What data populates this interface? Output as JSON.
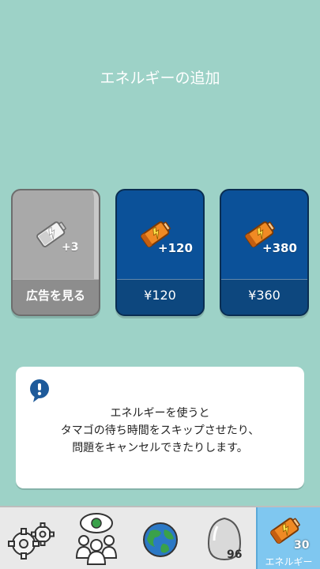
{
  "header": {
    "title": "エネルギーの追加"
  },
  "cards": [
    {
      "amount": "+3",
      "price": "広告を見る"
    },
    {
      "amount": "+120",
      "price": "¥120"
    },
    {
      "amount": "+380",
      "price": "¥360"
    }
  ],
  "info": {
    "lines": [
      "エネルギーを使うと",
      "タマゴの待ち時間をスキップさせたり、",
      "問題をキャンセルできたりします。"
    ]
  },
  "tabs": {
    "egg_count": "96",
    "energy_count": "30",
    "energy_label": "エネルギー"
  },
  "colors": {
    "background": "#9dd2c7",
    "card_blue": "#0b5199",
    "card_gray": "#a9a9a9",
    "active_tab": "#7fc7f0",
    "info_icon": "#1e5a9a"
  },
  "icons": {
    "info": "info-bubble-icon",
    "battery": "battery-icon",
    "settings": "gears-icon",
    "people": "people-icon",
    "globe": "globe-icon",
    "egg": "egg-icon"
  }
}
